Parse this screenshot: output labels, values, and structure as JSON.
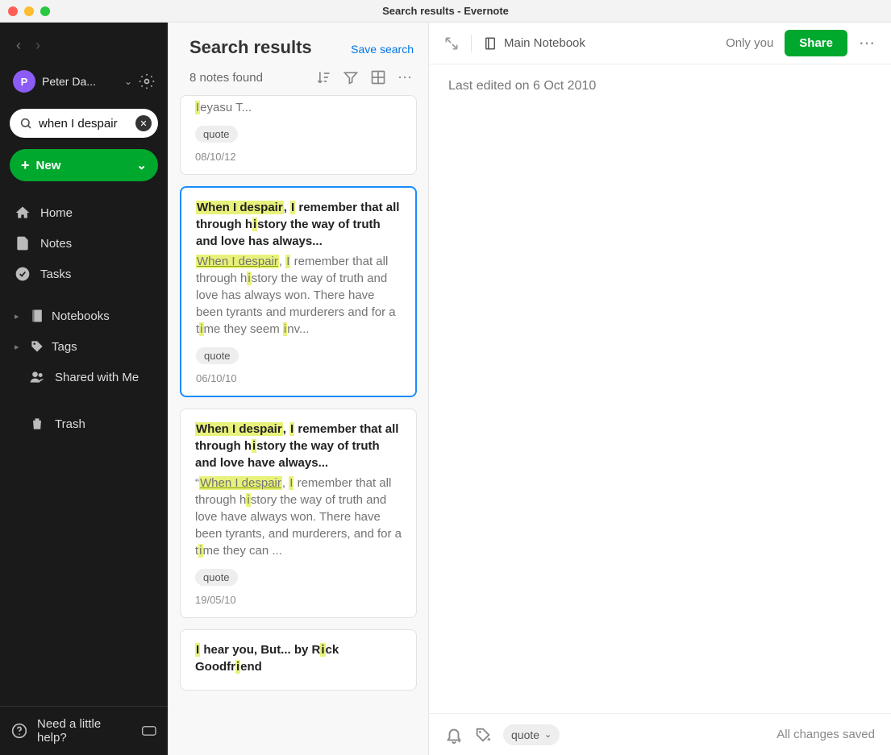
{
  "window": {
    "title": "Search results - Evernote"
  },
  "sidebar": {
    "user": {
      "initial": "P",
      "name": "Peter Da..."
    },
    "search": {
      "query": "when I despair"
    },
    "new_label": "New",
    "items": {
      "home": "Home",
      "notes": "Notes",
      "tasks": "Tasks",
      "notebooks": "Notebooks",
      "tags": "Tags",
      "shared": "Shared with Me",
      "trash": "Trash",
      "help": "Need a little help?"
    }
  },
  "list": {
    "title": "Search results",
    "save": "Save search",
    "count": "8 notes found",
    "cards": [
      {
        "snippet_html": "<mark>I</mark>eyasu T...",
        "tag": "quote",
        "date": "08/10/12",
        "partial": true
      },
      {
        "title_html": "<mark>When I despair</mark>, <mark>I</mark> remember that all through h<mark>i</mark>story the way of truth and love has always...",
        "body_html": "<mark class='u'>When I despair</mark>, <mark>I</mark> remember that all through h<mark>i</mark>story the way of truth and love has always won. There have been tyrants and murderers and for a t<mark>i</mark>me they seem <mark>i</mark>nv...",
        "tag": "quote",
        "date": "06/10/10",
        "selected": true
      },
      {
        "title_html": "<mark>When I despair</mark>, <mark>I</mark> remember that all through h<mark>i</mark>story the way of truth and love have always...",
        "body_html": "“<mark class='u'>When I despair</mark>, <mark>I</mark> remember that all through h<mark>i</mark>story the way of truth and love have always won. There have been tyrants, and murderers, and for a t<mark>i</mark>me they can ...",
        "tag": "quote",
        "date": "19/05/10"
      },
      {
        "title_html": "<mark>I</mark> hear you, But... by R<mark>i</mark>ck Goodfr<mark>i</mark>end",
        "cutoff": true
      }
    ]
  },
  "editor": {
    "notebook": "Main Notebook",
    "visibility": "Only you",
    "share": "Share",
    "last_edited": "Last edited on 6 Oct 2010",
    "tag": "quote",
    "saved": "All changes saved"
  }
}
